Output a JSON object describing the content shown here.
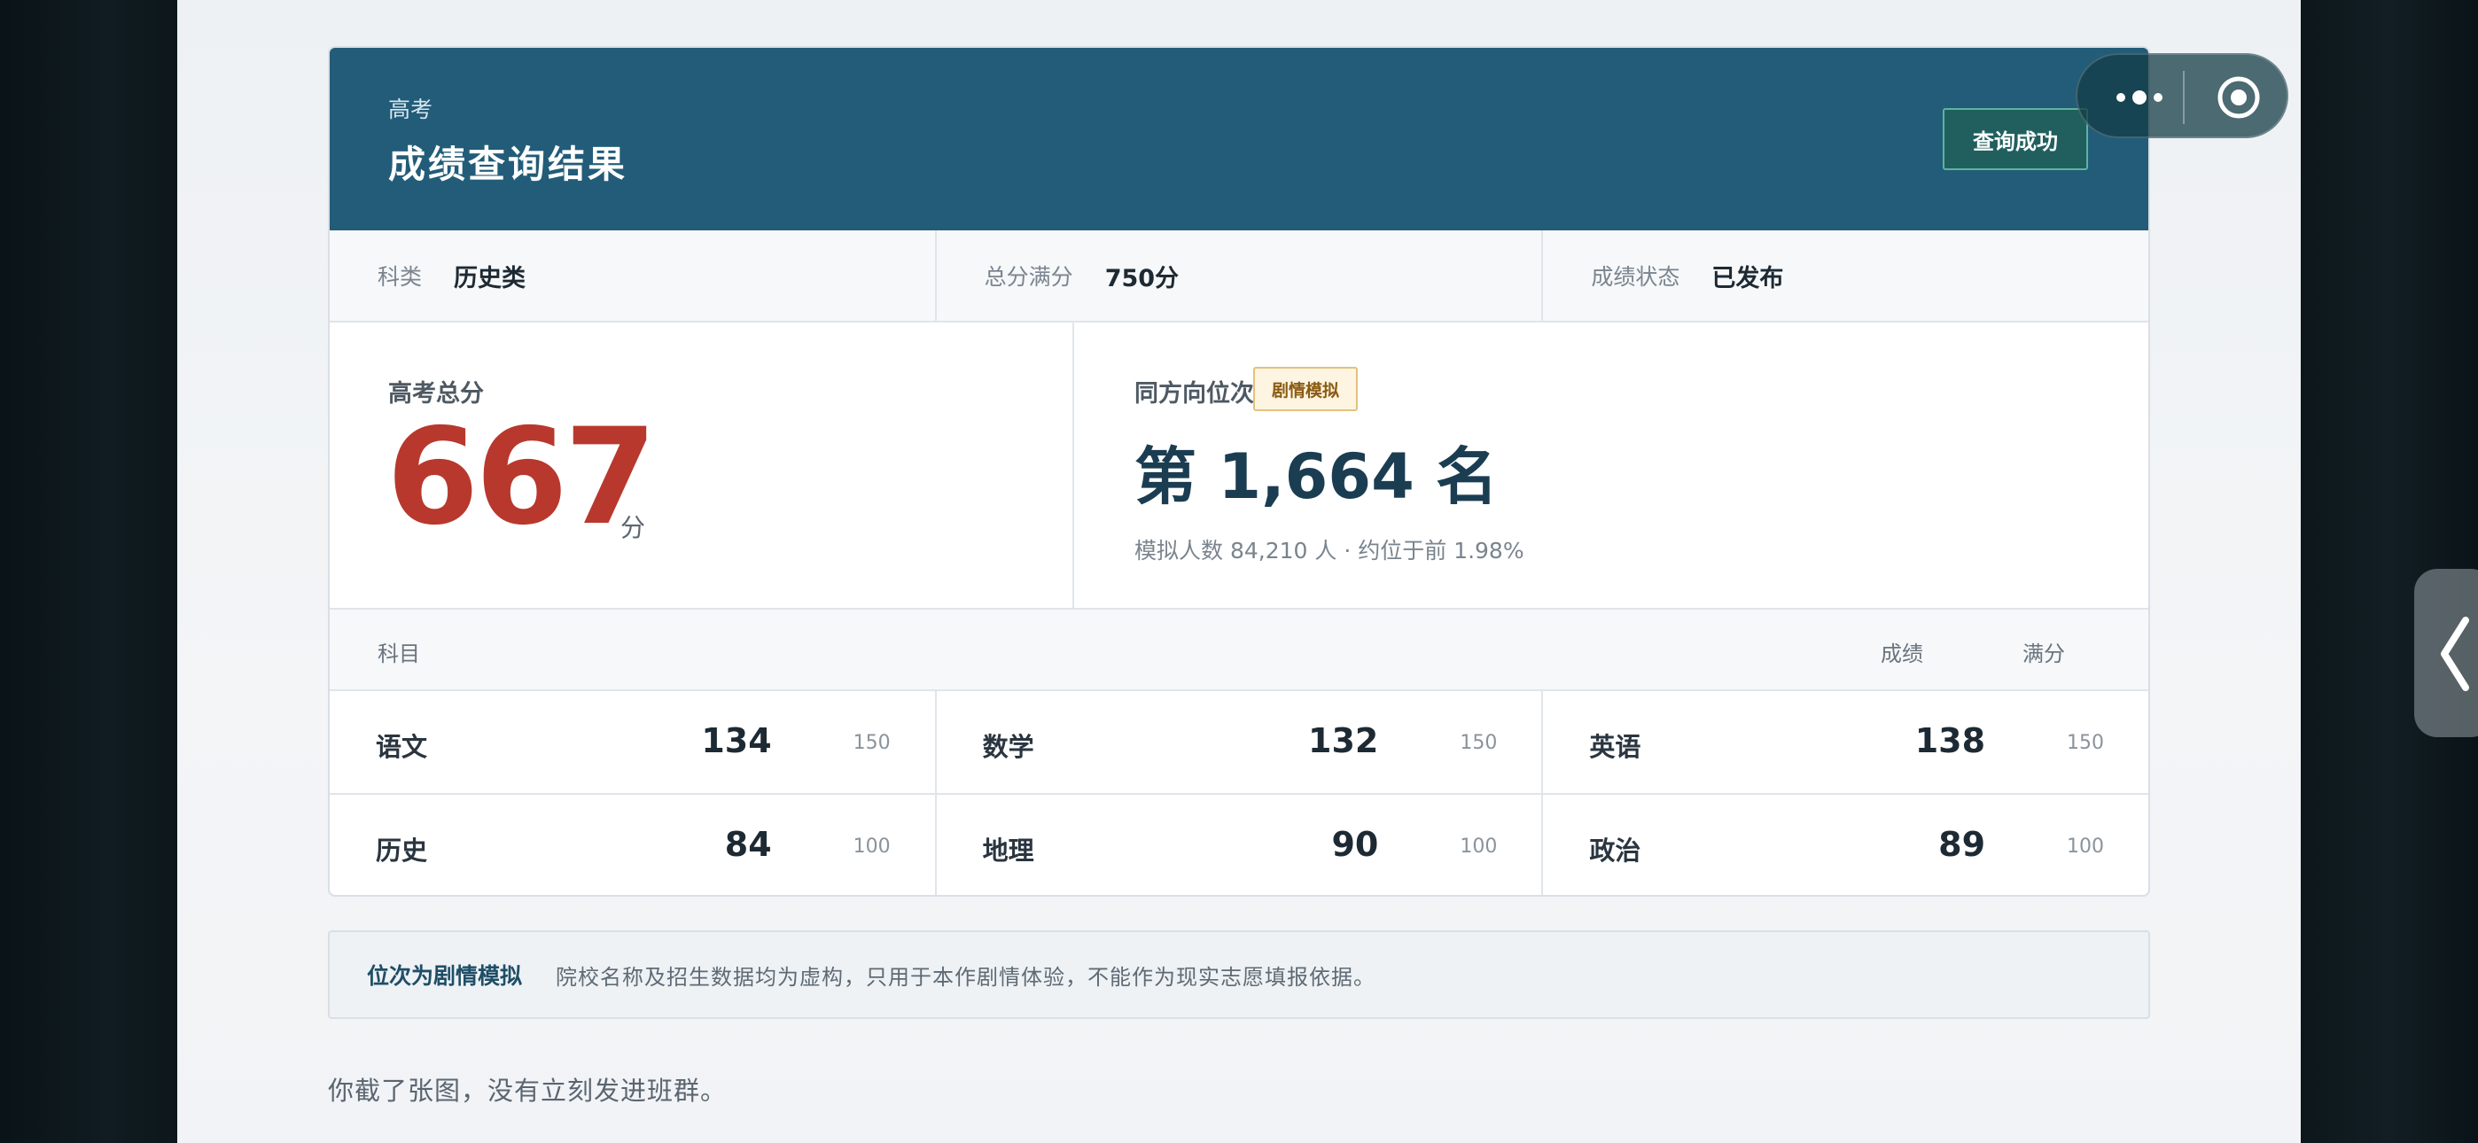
{
  "header": {
    "eyebrow": "高考",
    "title": "成绩查询结果",
    "badge": "查询成功"
  },
  "info": [
    {
      "label": "科类",
      "value": "历史类"
    },
    {
      "label": "总分满分",
      "value": "750分"
    },
    {
      "label": "成绩状态",
      "value": "已发布"
    }
  ],
  "score": {
    "label": "高考总分",
    "total": "667",
    "unit": "分"
  },
  "rank": {
    "label": "同方向位次",
    "tag": "剧情模拟",
    "text": "第 1,664 名",
    "sub": "模拟人数 84,210 人 · 约位于前 1.98%"
  },
  "subjects_header": {
    "subject": "科目",
    "score": "成绩",
    "full": "满分"
  },
  "subjects": [
    {
      "name": "语文",
      "score": "134",
      "full": "150"
    },
    {
      "name": "数学",
      "score": "132",
      "full": "150"
    },
    {
      "name": "英语",
      "score": "138",
      "full": "150"
    },
    {
      "name": "历史",
      "score": "84",
      "full": "100"
    },
    {
      "name": "地理",
      "score": "90",
      "full": "100"
    },
    {
      "name": "政治",
      "score": "89",
      "full": "100"
    }
  ],
  "notice": {
    "bold": "位次为剧情模拟",
    "text": "院校名称及招生数据均为虚构，只用于本作剧情体验，不能作为现实志愿填报依据。"
  },
  "footer": "你截了张图，没有立刻发进班群。",
  "icons": {
    "capsule_more": "more-dots-icon",
    "capsule_record": "record-icon",
    "side_tab": "chevron-left-icon"
  },
  "colors": {
    "header_bg": "#225c78",
    "score_red": "#b8382d",
    "rank_navy": "#1b3d52",
    "tag_gold": "#8a5a12"
  }
}
